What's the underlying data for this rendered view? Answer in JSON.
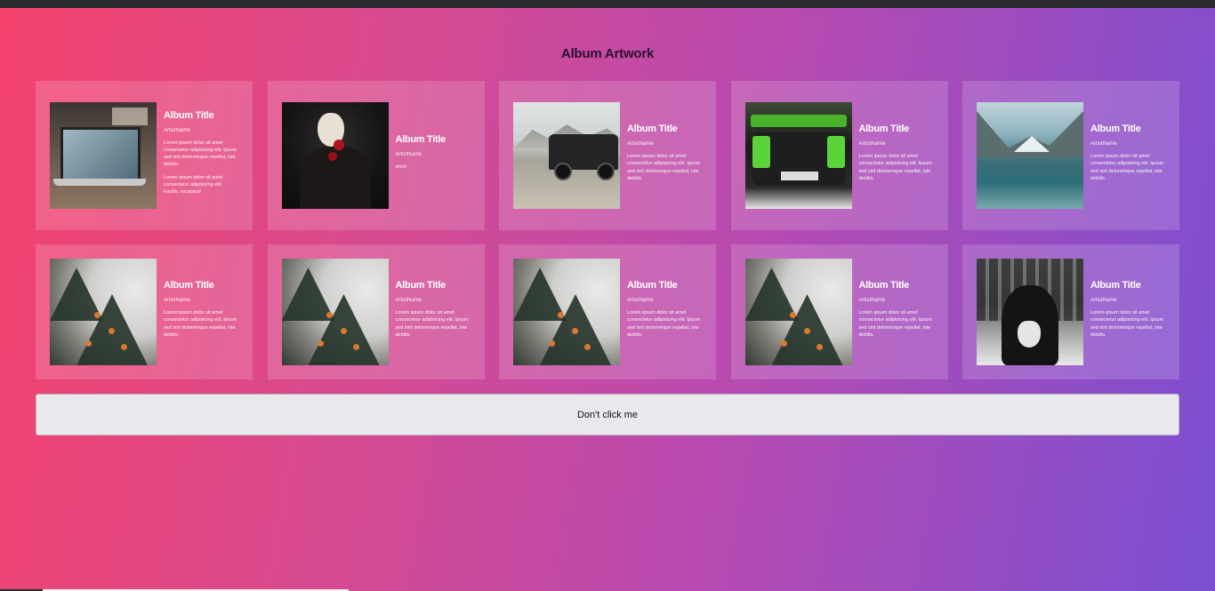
{
  "page": {
    "heading": "Album Artwork",
    "button_label": "Don't click me"
  },
  "albums": [
    {
      "title": "Album Title",
      "artist": "ArtistName",
      "desc": [
        "Lorem ipsum dolor sit amet consectetur adipisicing elit. Ipsum sed sint doloremque repellat, iste debitis.",
        "Lorem ipsum dolor sit amet consectetur adipisicing elit. Facilis, excepturi!"
      ],
      "image": "laptop-photo"
    },
    {
      "title": "Album Title",
      "artist": "ArtistName",
      "desc": [
        "short"
      ],
      "image": "mask-rose-photo"
    },
    {
      "title": "Album Title",
      "artist": "ArtistName",
      "desc": [
        "Lorem ipsum dolor sit amet consectetur adipisicing elit. Ipsum sed sint doloremque repellat, iste debitis."
      ],
      "image": "truck-photo"
    },
    {
      "title": "Album Title",
      "artist": "ArtistName",
      "desc": [
        "Lorem ipsum dolor sit amet consectetur adipisicing elit. Ipsum sed sint doloremque repellat, iste debitis."
      ],
      "image": "car-photo"
    },
    {
      "title": "Album Title",
      "artist": "ArtistName",
      "desc": [
        "Lorem ipsum dolor sit amet consectetur adipisicing elit. Ipsum sed sint doloremque repellat, iste debitis."
      ],
      "image": "lake-photo"
    },
    {
      "title": "Album Title",
      "artist": "ArtistName",
      "desc": [
        "Lorem ipsum dolor sit amet consectetur adipisicing elit. Ipsum sed sint doloremque repellat, iste debitis."
      ],
      "image": "tree-photo"
    },
    {
      "title": "Album Title",
      "artist": "ArtistName",
      "desc": [
        "Lorem ipsum dolor sit amet consectetur adipisicing elit. Ipsum sed sint doloremque repellat, iste debitis."
      ],
      "image": "tree-photo"
    },
    {
      "title": "Album Title",
      "artist": "ArtistName",
      "desc": [
        "Lorem ipsum dolor sit amet consectetur adipisicing elit. Ipsum sed sint doloremque repellat, iste debitis."
      ],
      "image": "tree-photo"
    },
    {
      "title": "Album Title",
      "artist": "ArtistName",
      "desc": [
        "Lorem ipsum dolor sit amet consectetur adipisicing elit. Ipsum sed sint doloremque repellat, iste debitis."
      ],
      "image": "tree-photo"
    },
    {
      "title": "Album Title",
      "artist": "ArtistName",
      "desc": [
        "Lorem ipsum dolor sit amet consectetur adipisicing elit. Ipsum sed sint doloremque repellat, iste debitis."
      ],
      "image": "anonymous-photo"
    }
  ],
  "colors": {
    "gradient_start": "#f4426c",
    "gradient_end": "#7a4fd2",
    "heading": "#2a1030",
    "button_bg": "#e9e8ed"
  }
}
